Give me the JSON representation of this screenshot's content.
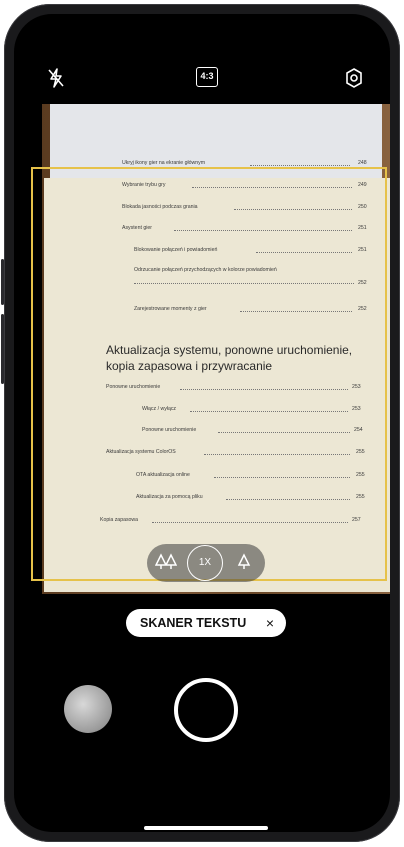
{
  "topbar": {
    "flash_icon": "flash-off-icon",
    "ratio_label": "4:3",
    "settings_icon": "gear-icon"
  },
  "document": {
    "toc_top": [
      {
        "text": "Ukryj ikony gier na ekranie głównym",
        "page": "248"
      },
      {
        "text": "Wybranie trybu gry",
        "page": "249"
      },
      {
        "text": "Blokada jasności podczas grania",
        "page": "250"
      },
      {
        "text": "Asystent gier",
        "page": "251"
      },
      {
        "text": "Blokowanie połączeń i powiadomień",
        "page": "251"
      },
      {
        "text": "Odrzucanie połączeń przychodzących w kolorze powiadomień",
        "page": "252"
      },
      {
        "text": "Zarejestrowane momenty z gier",
        "page": "252"
      }
    ],
    "heading_line1": "Aktualizacja systemu, ponowne uruchomienie,",
    "heading_line2": "kopia zapasowa i przywracanie",
    "toc_bottom": [
      {
        "text": "Ponowne uruchomienie",
        "page": "253"
      },
      {
        "text": "Włącz / wyłącz",
        "page": "253"
      },
      {
        "text": "Ponowne uruchomienie",
        "page": "254"
      },
      {
        "text": "Aktualizacja systemu ColorOS",
        "page": "255"
      },
      {
        "text": "OTA aktualizacja online",
        "page": "255"
      },
      {
        "text": "Aktualizacja za pomocą pliku",
        "page": "255"
      },
      {
        "text": "Kopia zapasowa",
        "page": "257"
      }
    ]
  },
  "zoom": {
    "left_icon": "trees-icon",
    "current": "1X",
    "right_icon": "tree-icon"
  },
  "mode_pill": {
    "label": "SKANER TEKSTU",
    "close": "×"
  },
  "colors": {
    "frame": "#e6c24a",
    "background": "#000000"
  }
}
